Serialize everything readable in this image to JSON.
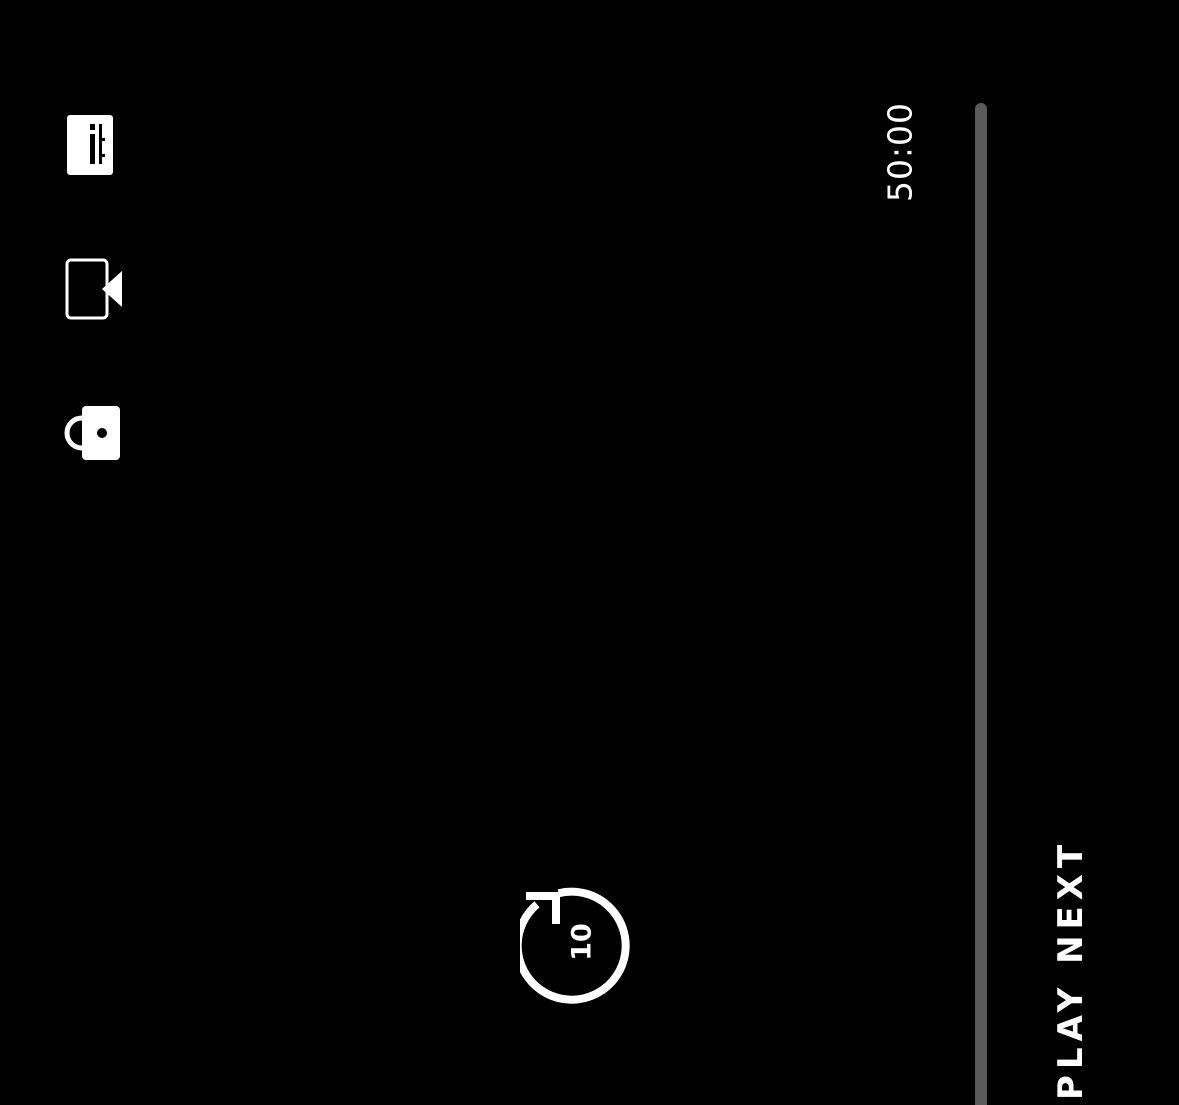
{
  "player": {
    "time_remaining": "50:00",
    "progress_fraction": 0,
    "rewind_seconds": "10",
    "play_next_label": "PLAY NEXT"
  },
  "side_controls": {
    "icons": [
      "subtitles-icon",
      "episodes-icon",
      "lock-icon"
    ]
  },
  "colors": {
    "background": "#000000",
    "foreground": "#ffffff",
    "track": "#5a5a5a",
    "accent": "#e50914"
  }
}
